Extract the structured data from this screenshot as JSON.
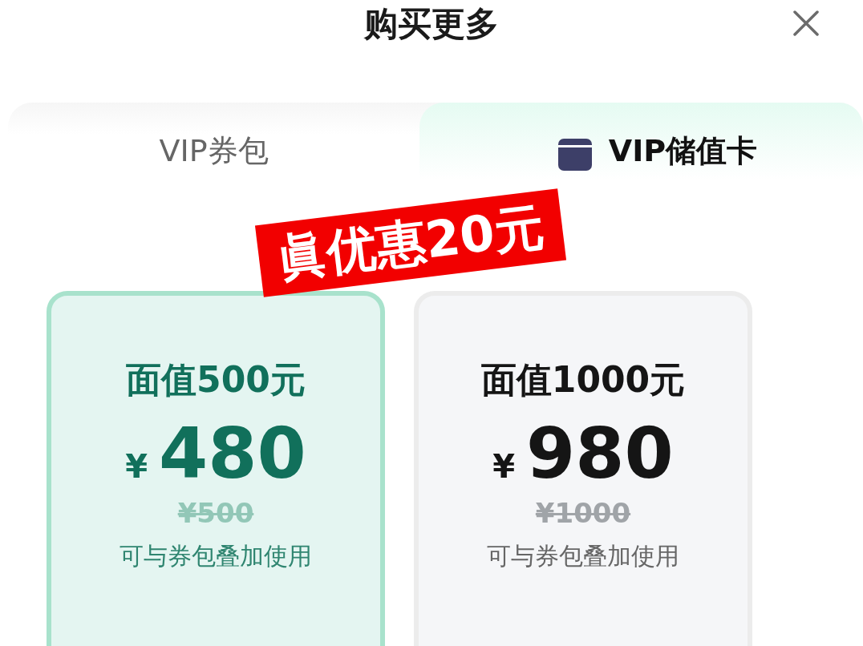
{
  "header": {
    "title": "购买更多"
  },
  "tabs": [
    {
      "label": "VIP券包",
      "selected": false
    },
    {
      "label": "VIP储值卡",
      "selected": true
    }
  ],
  "promo_badge": {
    "text": "眞优惠20元"
  },
  "cards": [
    {
      "face_value": "面值500元",
      "currency": "¥",
      "price": "480",
      "original_price": "¥500",
      "note": "可与券包叠加使用",
      "selected": true
    },
    {
      "face_value": "面值1000元",
      "currency": "¥",
      "price": "980",
      "original_price": "¥1000",
      "note": "可与券包叠加使用",
      "selected": false
    }
  ]
}
